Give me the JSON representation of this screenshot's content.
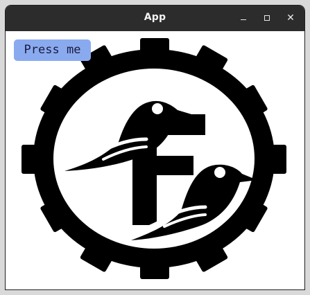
{
  "window": {
    "title": "App",
    "controls": {
      "minimize_icon": "minimize-icon",
      "maximize_icon": "maximize-icon",
      "close_icon": "close-icon",
      "close_glyph": "✕"
    }
  },
  "content": {
    "button_label": "Press me",
    "logo": {
      "letter": "F",
      "description_icon": "gear-birds-logo"
    }
  },
  "colors": {
    "titlebar": "#2c2c2c",
    "button": "#8aaaf0",
    "logo": "#000000",
    "background": "#ffffff"
  }
}
